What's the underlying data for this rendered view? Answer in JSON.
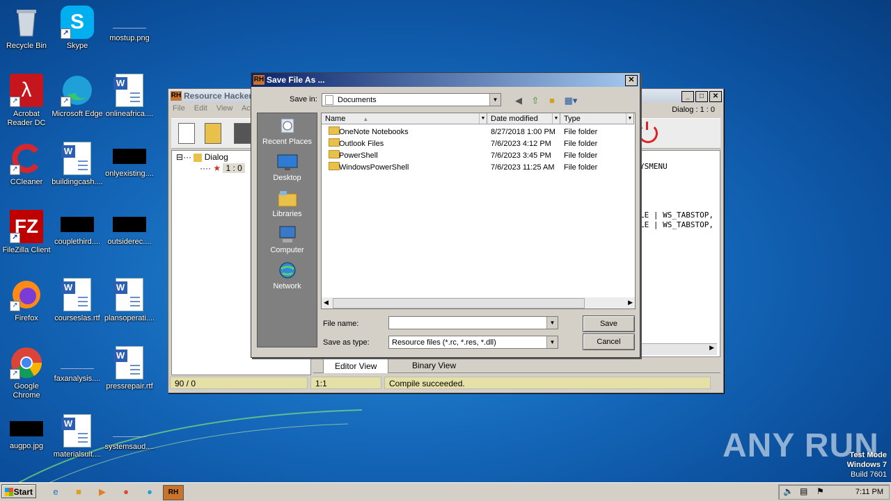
{
  "desktop": {
    "icons": [
      {
        "label": "Recycle Bin"
      },
      {
        "label": "Skype"
      },
      {
        "label": "mostup.png"
      },
      {
        "label": "Acrobat Reader DC"
      },
      {
        "label": "Microsoft Edge"
      },
      {
        "label": "onlineafrica...."
      },
      {
        "label": "CCleaner"
      },
      {
        "label": "buildingcash...."
      },
      {
        "label": "onlyexisting...."
      },
      {
        "label": "FileZilla Client"
      },
      {
        "label": "couplethird...."
      },
      {
        "label": "outsiderec...."
      },
      {
        "label": "Firefox"
      },
      {
        "label": "courseslas.rtf"
      },
      {
        "label": "plansoperati...."
      },
      {
        "label": "Google Chrome"
      },
      {
        "label": "faxanalysis...."
      },
      {
        "label": "pressrepair.rtf"
      },
      {
        "label": "augpo.jpg"
      },
      {
        "label": "materialsuit...."
      },
      {
        "label": "systemsaud...."
      }
    ]
  },
  "rh_window": {
    "title": "Resource Hacker",
    "menu": [
      "File",
      "Edit",
      "View",
      "Acti"
    ],
    "dialog_label": "Dialog : 1 : 0",
    "tree": {
      "root": "Dialog",
      "child": "1 : 0"
    },
    "editor_lines": [
      "YSMENU",
      "LE | WS_TABSTOP,",
      "LE | WS_TABSTOP,"
    ],
    "tabs": [
      "Editor View",
      "Binary View"
    ],
    "status": [
      "90 / 0",
      "1:1",
      "Compile succeeded."
    ]
  },
  "save_dialog": {
    "title": "Save File As ...",
    "save_in_label": "Save in:",
    "save_in_value": "Documents",
    "places": [
      "Recent Places",
      "Desktop",
      "Libraries",
      "Computer",
      "Network"
    ],
    "columns": [
      "Name",
      "Date modified",
      "Type"
    ],
    "files": [
      {
        "name": "OneNote Notebooks",
        "date": "8/27/2018 1:00 PM",
        "type": "File folder"
      },
      {
        "name": "Outlook Files",
        "date": "7/6/2023 4:12 PM",
        "type": "File folder"
      },
      {
        "name": "PowerShell",
        "date": "7/6/2023 3:45 PM",
        "type": "File folder"
      },
      {
        "name": "WindowsPowerShell",
        "date": "7/6/2023 11:25 AM",
        "type": "File folder"
      }
    ],
    "file_name_label": "File name:",
    "file_name_value": "",
    "save_as_type_label": "Save as type:",
    "save_as_type_value": "Resource files (*.rc, *.res, *.dll)",
    "save_button": "Save",
    "cancel_button": "Cancel"
  },
  "watermark": "ANY RUN",
  "test_mode": [
    "Test Mode",
    "Windows 7",
    "Build 7601"
  ],
  "taskbar": {
    "start_label": "Start",
    "clock": "7:11 PM"
  }
}
